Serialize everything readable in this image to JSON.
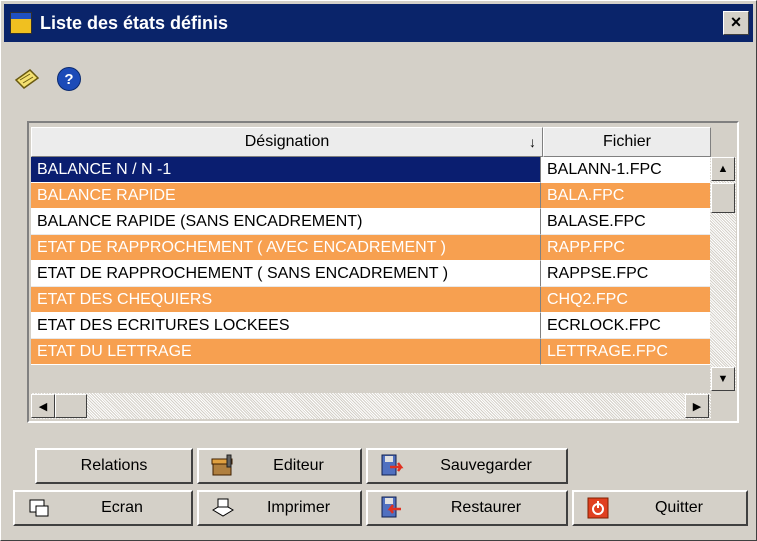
{
  "window": {
    "title": "Liste des états définis",
    "close_label": "×"
  },
  "toolbar": {
    "icons": [
      "pencil-note-icon",
      "help-icon"
    ],
    "help_glyph": "?"
  },
  "grid": {
    "columns": [
      "Désignation",
      "Fichier"
    ],
    "sort_glyph": "↓",
    "rows": [
      {
        "designation": "BALANCE N / N -1",
        "fichier": "BALANN-1.FPC",
        "style": "selected"
      },
      {
        "designation": "BALANCE RAPIDE",
        "fichier": "BALA.FPC",
        "style": "orange"
      },
      {
        "designation": "BALANCE RAPIDE (SANS ENCADREMENT)",
        "fichier": "BALASE.FPC",
        "style": "white"
      },
      {
        "designation": "ETAT DE RAPPROCHEMENT ( AVEC ENCADREMENT )",
        "fichier": "RAPP.FPC",
        "style": "orange"
      },
      {
        "designation": "ETAT DE RAPPROCHEMENT ( SANS ENCADREMENT )",
        "fichier": "RAPPSE.FPC",
        "style": "white"
      },
      {
        "designation": "ETAT DES CHEQUIERS",
        "fichier": "CHQ2.FPC",
        "style": "orange"
      },
      {
        "designation": "ETAT DES ECRITURES LOCKEES",
        "fichier": "ECRLOCK.FPC",
        "style": "white"
      },
      {
        "designation": "ETAT DU LETTRAGE",
        "fichier": "LETTRAGE.FPC",
        "style": "orange"
      }
    ]
  },
  "buttons": {
    "relations": "Relations",
    "editeur": "Editeur",
    "sauvegarder": "Sauvegarder",
    "ecran": "Ecran",
    "imprimer": "Imprimer",
    "restaurer": "Restaurer",
    "quitter": "Quitter"
  },
  "colors": {
    "title_bar": "#0a246a",
    "selected_row": "#0a1e70",
    "orange_row": "#f7a050"
  }
}
